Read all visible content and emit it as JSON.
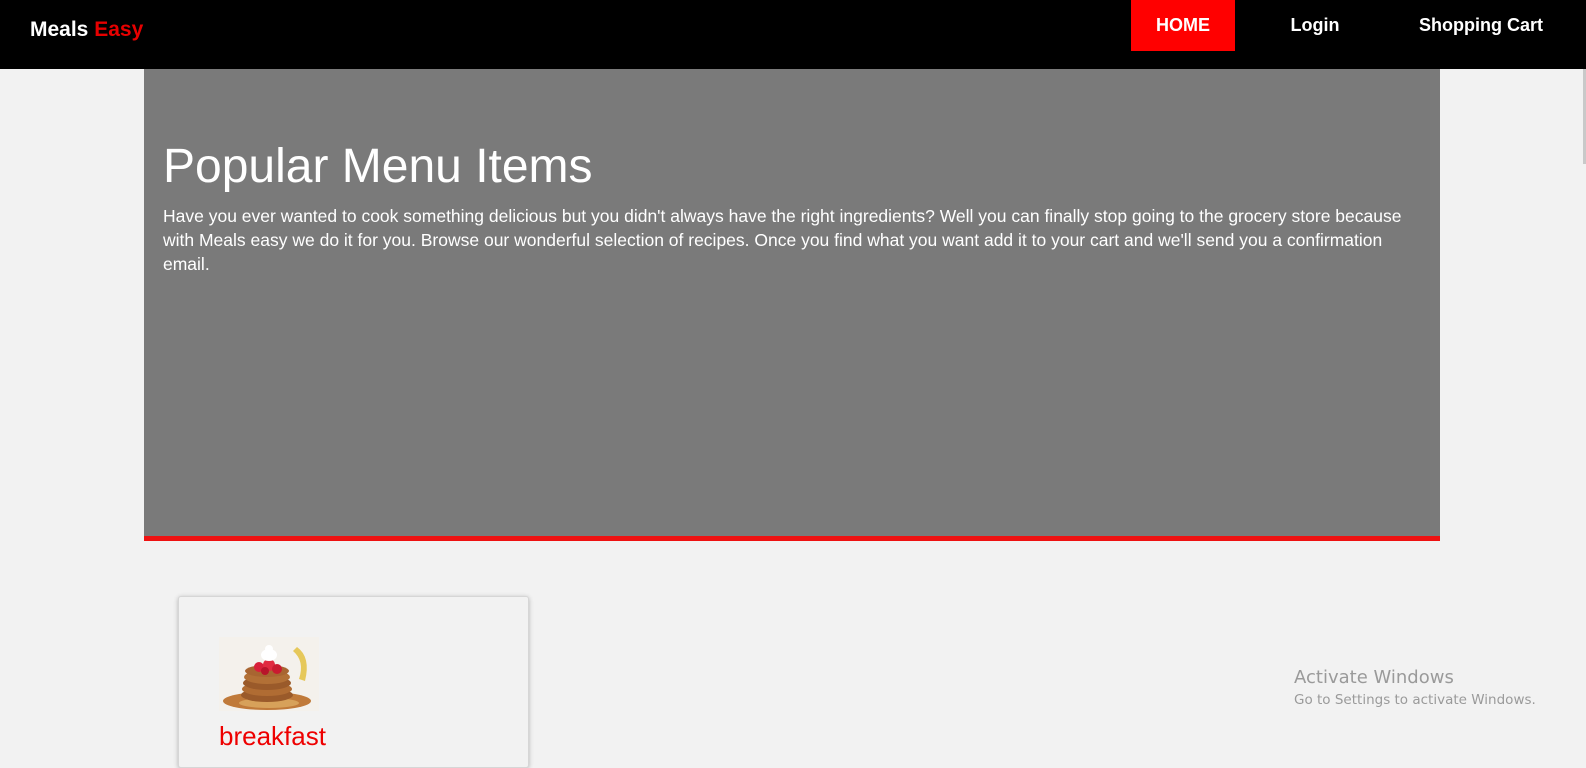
{
  "navbar": {
    "brand_part1": "Meals",
    "brand_part2": "Easy",
    "items": [
      {
        "label": "HOME"
      },
      {
        "label": "Login"
      },
      {
        "label": "Shopping Cart"
      }
    ]
  },
  "hero": {
    "title": "Popular Menu Items",
    "description": "Have you ever wanted to cook something delicious but you didn't always have the right ingredients? Well you can finally stop going to the grocery store because with Meals easy we do it for you. Browse our wonderful selection of recipes. Once you find what you want add it to your cart and we'll send you a confirmation email."
  },
  "menu_items": [
    {
      "title": "breakfast",
      "image": "pancake-stack-with-strawberries"
    }
  ],
  "watermark": {
    "title": "Activate Windows",
    "subtitle": "Go to Settings to activate Windows."
  },
  "colors": {
    "navbar_bg": "#000000",
    "accent_red": "#ff0000",
    "hero_bg": "#7a7a7a",
    "page_bg": "#f2f2f2"
  }
}
